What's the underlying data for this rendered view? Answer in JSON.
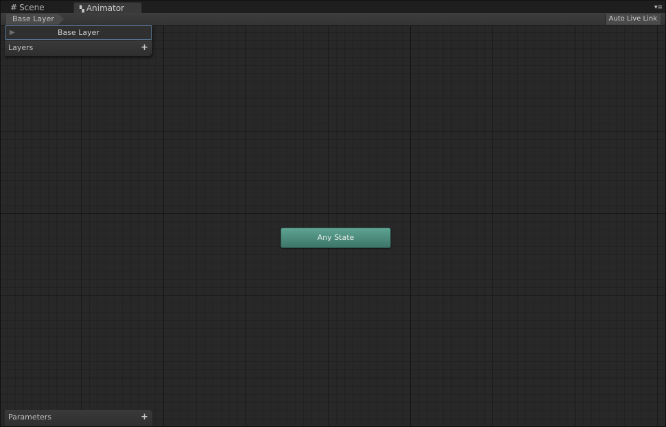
{
  "tabs": [
    {
      "label": "Scene",
      "icon": "grid-icon",
      "active": false
    },
    {
      "label": "Animator",
      "icon": "animator-icon",
      "active": true
    }
  ],
  "toolbar": {
    "breadcrumb": "Base Layer",
    "auto_live_link_label": "Auto Live Link",
    "menu_icon": "▾≡"
  },
  "layers_panel": {
    "title": "Layers",
    "add_icon": "+",
    "items": [
      {
        "label": "Base Layer",
        "selected": true
      }
    ]
  },
  "parameters_panel": {
    "title": "Parameters",
    "add_icon": "+"
  },
  "graph": {
    "nodes": [
      {
        "label": "Any State",
        "color": "#4f8f80"
      }
    ]
  }
}
